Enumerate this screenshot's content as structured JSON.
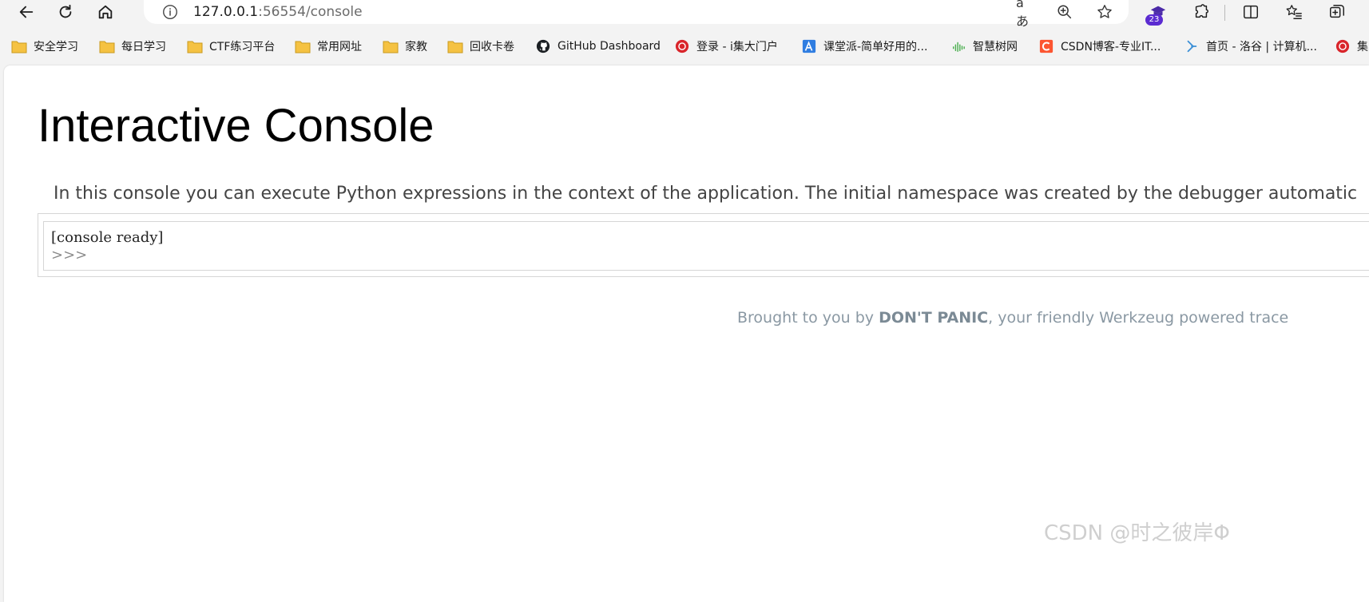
{
  "browser": {
    "url_host": "127.0.0.1",
    "url_rest": ":56554/console",
    "collections_badge": "23",
    "translate_glyph": "aあ"
  },
  "bookmarks": [
    {
      "label": "安全学习",
      "icon": "folder-icon"
    },
    {
      "label": "每日学习",
      "icon": "folder-icon"
    },
    {
      "label": "CTF练习平台",
      "icon": "folder-icon"
    },
    {
      "label": "常用网址",
      "icon": "folder-icon"
    },
    {
      "label": "家教",
      "icon": "folder-icon"
    },
    {
      "label": "回收卡卷",
      "icon": "folder-icon"
    },
    {
      "label": "GitHub Dashboard",
      "icon": "github-icon"
    },
    {
      "label": "登录 - i集大门户",
      "icon": "ijimei-icon"
    },
    {
      "label": "课堂派-简单好用的...",
      "icon": "ketangpai-icon"
    },
    {
      "label": "智慧树网",
      "icon": "zhihuishu-icon"
    },
    {
      "label": "CSDN博客-专业IT...",
      "icon": "csdn-icon"
    },
    {
      "label": "首页 - 洛谷 | 计算机...",
      "icon": "luogu-icon"
    },
    {
      "label": "集",
      "icon": "ijimei-icon"
    }
  ],
  "page": {
    "title": "Interactive Console",
    "explanation": "In this console you can execute Python expressions in the context of the application. The initial namespace was created by the debugger automatic",
    "console_output": "[console ready]",
    "prompt": ">>>",
    "footer_pre": "Brought to you by ",
    "footer_bold": "DON'T PANIC",
    "footer_post": ", your friendly Werkzeug powered trace"
  },
  "watermark": "CSDN @时之彼岸Φ",
  "colors": {
    "folder": "#f5c242",
    "badge": "#5b2bd1",
    "csdn": "#fc5531",
    "ijimei": "#d9252b",
    "footer": "#8a98a3"
  }
}
